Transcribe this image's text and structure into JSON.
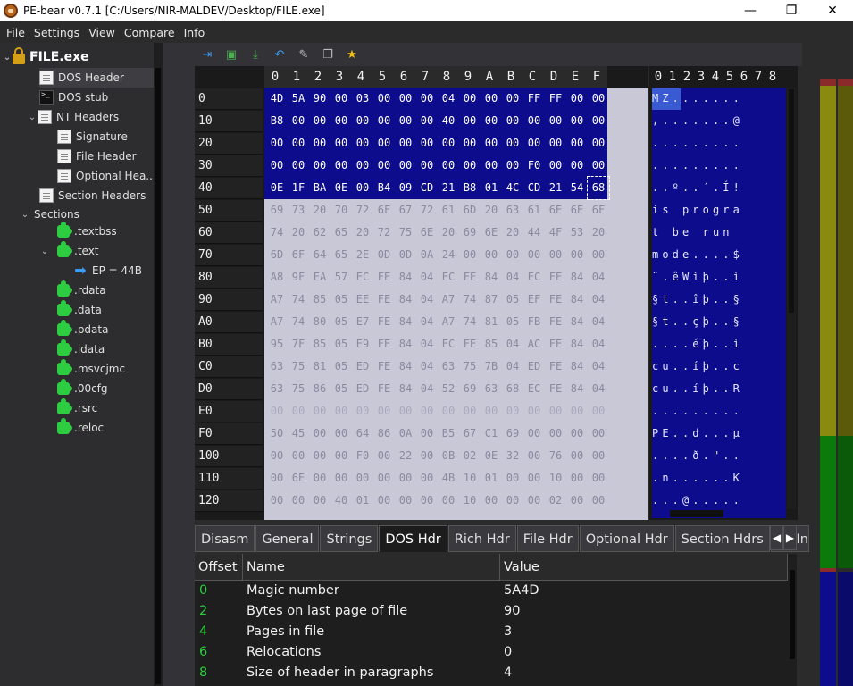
{
  "window": {
    "title": "PE-bear v0.7.1 [C:/Users/NIR-MALDEV/Desktop/FILE.exe]",
    "minimize": "—",
    "maximize": "❐",
    "close": "✕"
  },
  "menu": [
    "File",
    "Settings",
    "View",
    "Compare",
    "Info"
  ],
  "tree": {
    "root": "FILE.exe",
    "dos_header": "DOS Header",
    "dos_stub": "DOS stub",
    "nt_headers": "NT Headers",
    "signature": "Signature",
    "file_header": "File Header",
    "optional_header": "Optional Hea...",
    "section_headers": "Section Headers",
    "sections": "Sections",
    "section_items": [
      ".textbss",
      ".text",
      ".rdata",
      ".data",
      ".pdata",
      ".idata",
      ".msvcjmc",
      ".00cfg",
      ".rsrc",
      ".reloc"
    ],
    "ep": "EP = 44B"
  },
  "hex": {
    "columns": [
      "0",
      "1",
      "2",
      "3",
      "4",
      "5",
      "6",
      "7",
      "8",
      "9",
      "A",
      "B",
      "C",
      "D",
      "E",
      "F"
    ],
    "offsets": [
      "0",
      "10",
      "20",
      "30",
      "40",
      "50",
      "60",
      "70",
      "80",
      "90",
      "A0",
      "B0",
      "C0",
      "D0",
      "E0",
      "F0",
      "100",
      "110",
      "120"
    ],
    "rows": [
      "4D 5A 90 00 03 00 00 00 04 00 00 00 FF FF 00 00",
      "B8 00 00 00 00 00 00 00 40 00 00 00 00 00 00 00",
      "00 00 00 00 00 00 00 00 00 00 00 00 00 00 00 00",
      "00 00 00 00 00 00 00 00 00 00 00 00 F0 00 00 00",
      "0E 1F BA 0E 00 B4 09 CD 21 B8 01 4C CD 21 54 68",
      "69 73 20 70 72 6F 67 72 61 6D 20 63 61 6E 6E 6F",
      "74 20 62 65 20 72 75 6E 20 69 6E 20 44 4F 53 20",
      "6D 6F 64 65 2E 0D 0D 0A 24 00 00 00 00 00 00 00",
      "A8 9F EA 57 EC FE 84 04 EC FE 84 04 EC FE 84 04",
      "A7 74 85 05 EE FE 84 04 A7 74 87 05 EF FE 84 04",
      "A7 74 80 05 E7 FE 84 04 A7 74 81 05 FB FE 84 04",
      "95 7F 85 05 E9 FE 84 04 EC FE 85 04 AC FE 84 04",
      "63 75 81 05 ED FE 84 04 63 75 7B 04 ED FE 84 04",
      "63 75 86 05 ED FE 84 04 52 69 63 68 EC FE 84 04",
      "00 00 00 00 00 00 00 00 00 00 00 00 00 00 00 00",
      "50 45 00 00 64 86 0A 00 B5 67 C1 69 00 00 00 00",
      "00 00 00 00 F0 00 22 00 0B 02 0E 32 00 76 00 00",
      "00 6E 00 00 00 00 00 00 4B 10 01 00 00 10 00 00",
      "00 00 00 40 01 00 00 00 00 10 00 00 00 02 00 00"
    ]
  },
  "ascii": {
    "columns": [
      "0",
      "1",
      "2",
      "3",
      "4",
      "5",
      "6",
      "7",
      "8"
    ],
    "rows": [
      "MZ.......",
      ",.......@",
      ".........",
      ".........",
      "..º..´.Í!",
      "is progra",
      "t be run ",
      "mode....$",
      "¨.êWìþ..ì",
      "§t..îþ..§",
      "§t..çþ..§",
      "....éþ..ì",
      "cu..íþ..c",
      "cu..íþ..R",
      ".........",
      "PE..d...µ",
      "....ð.\"..",
      ".n......K",
      "...@....."
    ]
  },
  "tabs": [
    "Disasm",
    "General",
    "Strings",
    "DOS Hdr",
    "Rich Hdr",
    "File Hdr",
    "Optional Hdr",
    "Section Hdrs",
    "In"
  ],
  "tab_active": "DOS Hdr",
  "table": {
    "headers": [
      "Offset",
      "Name",
      "Value"
    ],
    "rows": [
      {
        "offset": "0",
        "name": "Magic number",
        "value": "5A4D"
      },
      {
        "offset": "2",
        "name": "Bytes on last page of file",
        "value": "90"
      },
      {
        "offset": "4",
        "name": "Pages in file",
        "value": "3"
      },
      {
        "offset": "6",
        "name": "Relocations",
        "value": "0"
      },
      {
        "offset": "8",
        "name": "Size of header in paragraphs",
        "value": "4"
      }
    ]
  },
  "colors": {
    "selection": "#0c0c8c",
    "hex_bg": "#c8c8d6",
    "offset_green": "#2ecc40",
    "strip_olive": "#8a8a10",
    "strip_green": "#0a7a0a",
    "strip_navy": "#0c0c8c"
  }
}
